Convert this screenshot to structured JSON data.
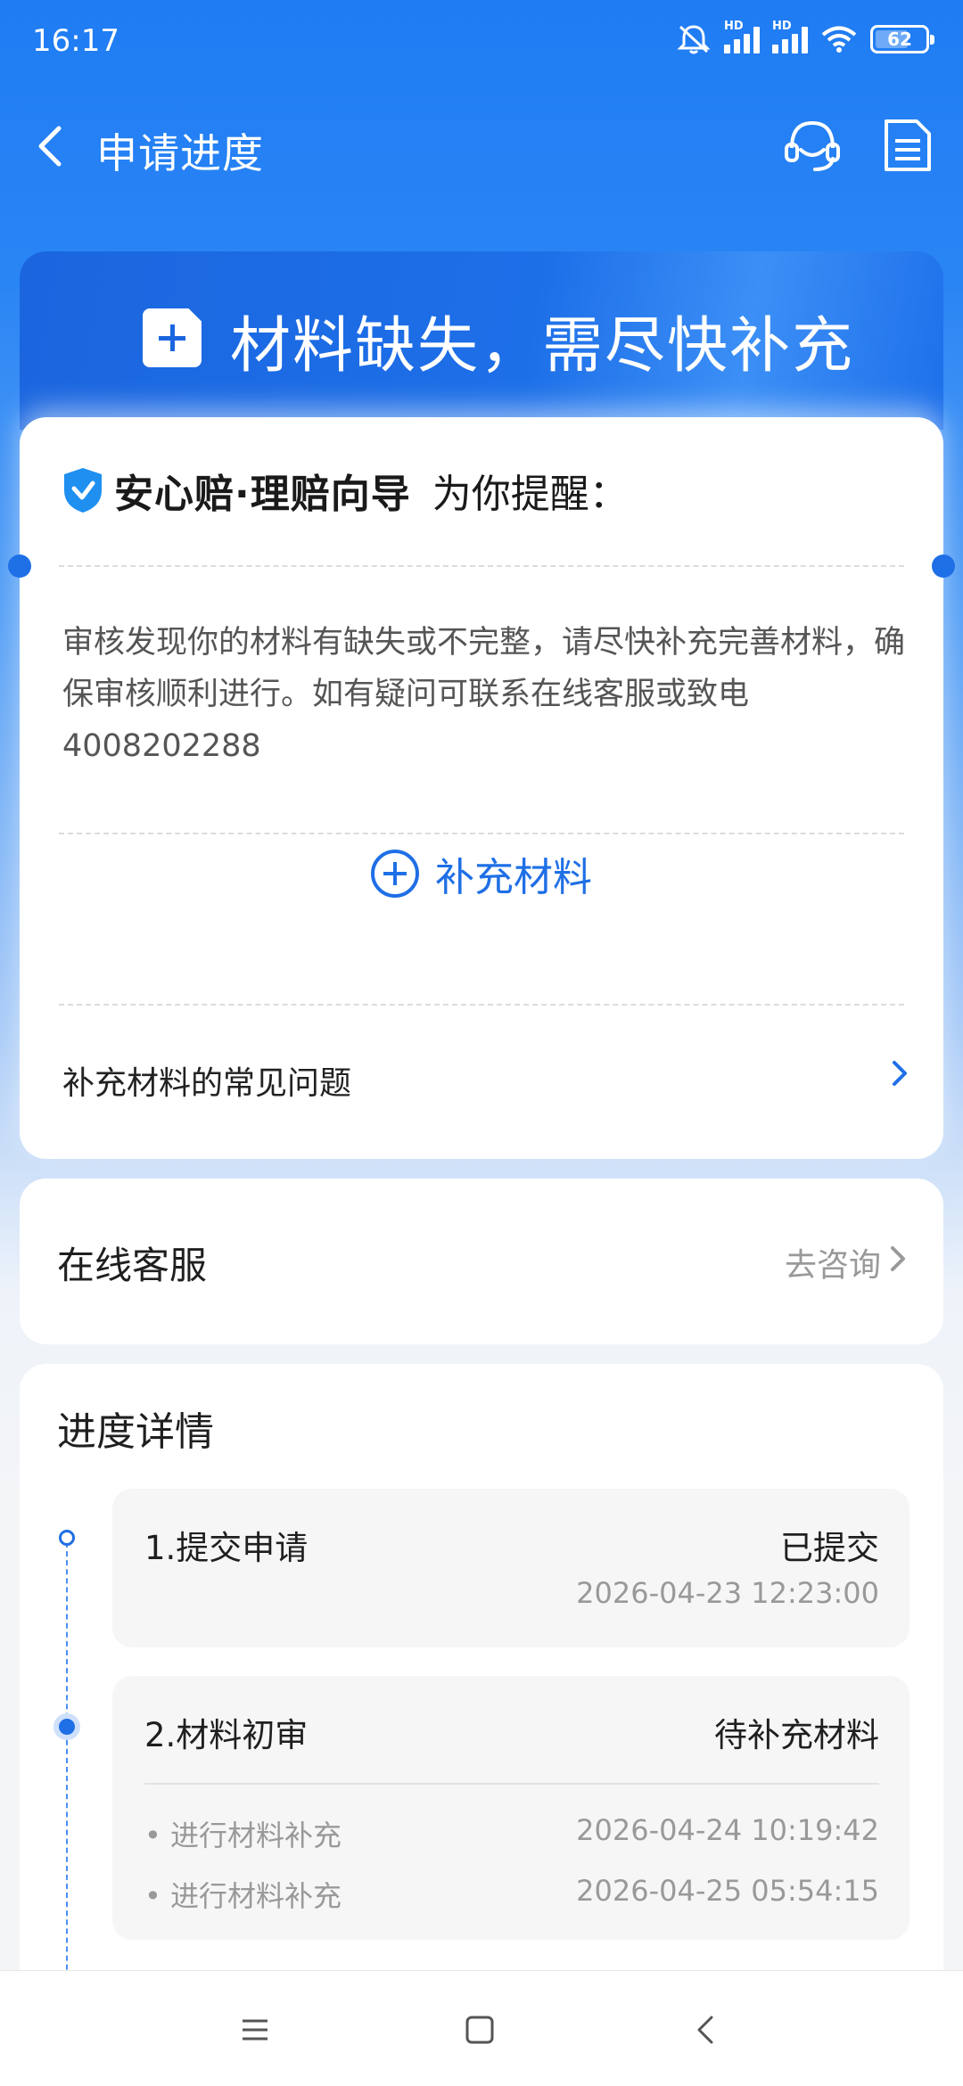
{
  "status_bar": {
    "time": "16:17",
    "battery": "62",
    "network_label_1": "HD",
    "network_label_2": "HD"
  },
  "nav": {
    "title": "申请进度",
    "icons": [
      "back-icon",
      "customer-service-icon",
      "document-icon"
    ]
  },
  "banner": {
    "title": "材料缺失，需尽快补充",
    "icon": "plus-file-icon"
  },
  "notice_card": {
    "brand": "安心赔·理赔向导",
    "remind": "为你提醒：",
    "message": "审核发现你的材料有缺失或不完整，请尽快补充完善材料，确保审核顺利进行。如有疑问可联系在线客服或致电4008202288",
    "supplement_button": "补充材料",
    "faq": "补充材料的常见问题"
  },
  "online_service": {
    "label": "在线客服",
    "action": "去咨询"
  },
  "progress": {
    "title": "进度详情",
    "steps": [
      {
        "name": "1.提交申请",
        "status": "已提交",
        "time": "2026-04-23 12:23:00"
      },
      {
        "name": "2.材料初审",
        "status": "待补充材料",
        "subs": [
          {
            "label": "进行材料补充",
            "time": "2026-04-24 10:19:42"
          },
          {
            "label": "进行材料补充",
            "time": "2026-04-25 05:54:15"
          }
        ]
      }
    ]
  },
  "colors": {
    "primary": "#1f6fe6",
    "banner": "#1b66df",
    "muted": "#999999"
  },
  "system_nav": [
    "menu-icon",
    "home-icon",
    "back-icon"
  ]
}
